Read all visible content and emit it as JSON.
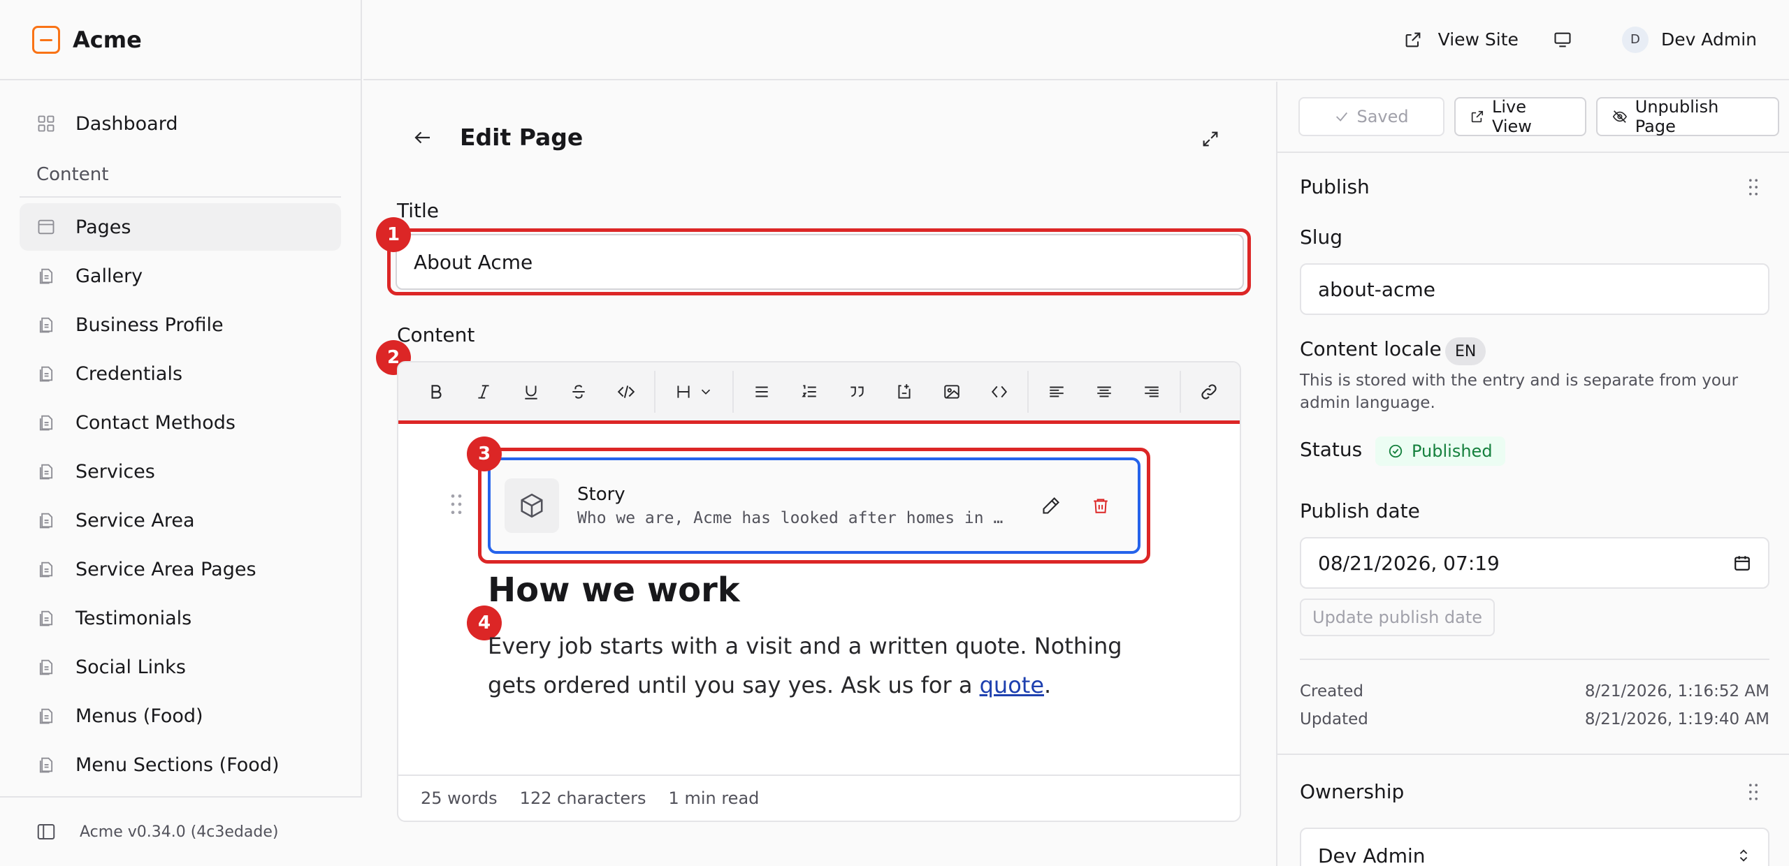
{
  "brand": {
    "name": "Acme"
  },
  "sidebar": {
    "dashboard": "Dashboard",
    "section_label": "Content",
    "items": [
      {
        "label": "Pages",
        "active": true
      },
      {
        "label": "Gallery"
      },
      {
        "label": "Business Profile"
      },
      {
        "label": "Credentials"
      },
      {
        "label": "Contact Methods"
      },
      {
        "label": "Services"
      },
      {
        "label": "Service Area"
      },
      {
        "label": "Service Area Pages"
      },
      {
        "label": "Testimonials"
      },
      {
        "label": "Social Links"
      },
      {
        "label": "Menus (Food)"
      },
      {
        "label": "Menu Sections (Food)"
      }
    ],
    "version": "Acme v0.34.0 (4c3edade)"
  },
  "topbar": {
    "view_site": "View Site",
    "user_initial": "D",
    "user_name": "Dev Admin"
  },
  "main": {
    "page_title": "Edit Page",
    "title_label": "Title",
    "title_value": "About Acme",
    "content_label": "Content",
    "badges": [
      "1",
      "2",
      "3",
      "4"
    ],
    "block": {
      "title": "Story",
      "description": "Who we are, Acme has looked after homes in the area for years."
    },
    "heading": "How we work",
    "paragraph_before": "Every job starts with a visit and a written quote. Nothing gets ordered until you say yes. Ask us for a ",
    "paragraph_link": "quote",
    "paragraph_after": ".",
    "stats": {
      "words": "25 words",
      "characters": "122 characters",
      "read": "1 min read"
    }
  },
  "panel": {
    "saved": "Saved",
    "live_view": "Live View",
    "unpublish": "Unpublish Page",
    "publish_title": "Publish",
    "slug_label": "Slug",
    "slug_value": "about-acme",
    "locale_label": "Content locale",
    "locale_value": "EN",
    "locale_help": "This is stored with the entry and is separate from your admin language.",
    "status_label": "Status",
    "status_value": "Published",
    "publish_date_label": "Publish date",
    "publish_date_value": "08/21/2026, 07:19",
    "update_date_button": "Update publish date",
    "created_label": "Created",
    "created_value": "8/21/2026, 1:16:52 AM",
    "updated_label": "Updated",
    "updated_value": "8/21/2026, 1:19:40 AM",
    "ownership_title": "Ownership",
    "owner_value": "Dev Admin"
  },
  "colors": {
    "accent": "#f97316",
    "highlight": "#dc2626",
    "selection": "#2563eb",
    "published": "#15803d"
  }
}
